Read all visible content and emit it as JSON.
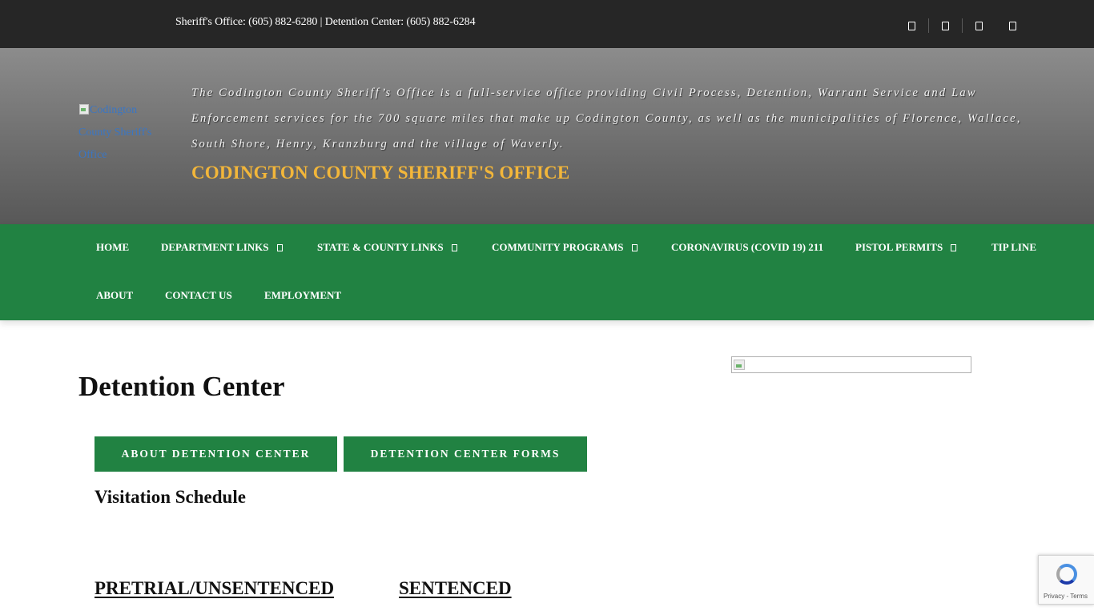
{
  "topbar": {
    "phones": "Sheriff's Office: (605) 882-6280 | Detention Center: (605) 882-6284",
    "social_icons": [
      "social-icon-1",
      "social-icon-2",
      "social-icon-3",
      "social-icon-4"
    ]
  },
  "header": {
    "logo_alt": "Codington County Sheriff's Office",
    "tagline": "The Codington County Sheriff’s Office is a full-service office providing Civil Process, Detention, Warrant Service and Law Enforcement services for the 700 square miles that make up Codington County, as well as the municipalities of Florence, Wallace, South Shore, Henry, Kranzburg and the village of Waverly.",
    "site_name": "CODINGTON COUNTY SHERIFF'S OFFICE",
    "site_name_color": "#f2b63a"
  },
  "nav": {
    "color": "#218242",
    "items": [
      {
        "label": "HOME",
        "has_dropdown": false
      },
      {
        "label": "DEPARTMENT LINKS",
        "has_dropdown": true
      },
      {
        "label": "STATE & COUNTY LINKS",
        "has_dropdown": true
      },
      {
        "label": "COMMUNITY PROGRAMS",
        "has_dropdown": true
      },
      {
        "label": "CORONAVIRUS (COVID 19) 211",
        "has_dropdown": false
      },
      {
        "label": "PISTOL PERMITS",
        "has_dropdown": true
      },
      {
        "label": "TIP LINE",
        "has_dropdown": false
      },
      {
        "label": "ABOUT",
        "has_dropdown": false
      },
      {
        "label": "CONTACT US",
        "has_dropdown": false
      },
      {
        "label": "EMPLOYMENT",
        "has_dropdown": false
      }
    ]
  },
  "main": {
    "title": "Detention Center",
    "buttons": {
      "about": "ABOUT DETENTION CENTER",
      "forms": "DETENTION CENTER FORMS"
    },
    "subheading": "Visitation Schedule",
    "columns": {
      "pretrial": "PRETRIAL/UNSENTENCED",
      "sentenced": "SENTENCED"
    }
  },
  "recaptcha": {
    "links": "Privacy - Terms"
  }
}
